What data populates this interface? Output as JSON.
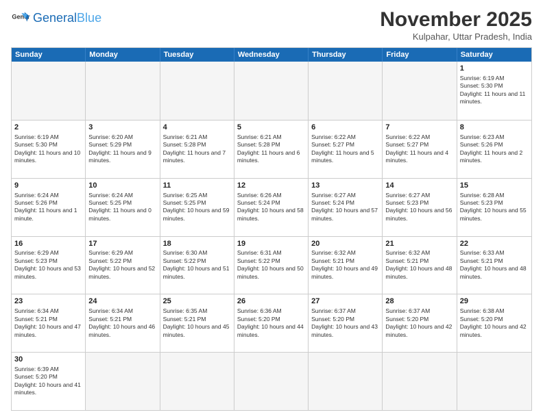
{
  "header": {
    "logo_general": "General",
    "logo_blue": "Blue",
    "month_title": "November 2025",
    "subtitle": "Kulpahar, Uttar Pradesh, India"
  },
  "day_headers": [
    "Sunday",
    "Monday",
    "Tuesday",
    "Wednesday",
    "Thursday",
    "Friday",
    "Saturday"
  ],
  "weeks": [
    [
      {
        "day": "",
        "empty": true
      },
      {
        "day": "",
        "empty": true
      },
      {
        "day": "",
        "empty": true
      },
      {
        "day": "",
        "empty": true
      },
      {
        "day": "",
        "empty": true
      },
      {
        "day": "",
        "empty": true
      },
      {
        "day": "1",
        "sunrise": "6:19 AM",
        "sunset": "5:30 PM",
        "daylight": "11 hours and 11 minutes."
      }
    ],
    [
      {
        "day": "2",
        "sunrise": "6:19 AM",
        "sunset": "5:30 PM",
        "daylight": "11 hours and 10 minutes."
      },
      {
        "day": "3",
        "sunrise": "6:20 AM",
        "sunset": "5:29 PM",
        "daylight": "11 hours and 9 minutes."
      },
      {
        "day": "4",
        "sunrise": "6:21 AM",
        "sunset": "5:28 PM",
        "daylight": "11 hours and 7 minutes."
      },
      {
        "day": "5",
        "sunrise": "6:21 AM",
        "sunset": "5:28 PM",
        "daylight": "11 hours and 6 minutes."
      },
      {
        "day": "6",
        "sunrise": "6:22 AM",
        "sunset": "5:27 PM",
        "daylight": "11 hours and 5 minutes."
      },
      {
        "day": "7",
        "sunrise": "6:22 AM",
        "sunset": "5:27 PM",
        "daylight": "11 hours and 4 minutes."
      },
      {
        "day": "8",
        "sunrise": "6:23 AM",
        "sunset": "5:26 PM",
        "daylight": "11 hours and 2 minutes."
      }
    ],
    [
      {
        "day": "9",
        "sunrise": "6:24 AM",
        "sunset": "5:26 PM",
        "daylight": "11 hours and 1 minute."
      },
      {
        "day": "10",
        "sunrise": "6:24 AM",
        "sunset": "5:25 PM",
        "daylight": "11 hours and 0 minutes."
      },
      {
        "day": "11",
        "sunrise": "6:25 AM",
        "sunset": "5:25 PM",
        "daylight": "10 hours and 59 minutes."
      },
      {
        "day": "12",
        "sunrise": "6:26 AM",
        "sunset": "5:24 PM",
        "daylight": "10 hours and 58 minutes."
      },
      {
        "day": "13",
        "sunrise": "6:27 AM",
        "sunset": "5:24 PM",
        "daylight": "10 hours and 57 minutes."
      },
      {
        "day": "14",
        "sunrise": "6:27 AM",
        "sunset": "5:23 PM",
        "daylight": "10 hours and 56 minutes."
      },
      {
        "day": "15",
        "sunrise": "6:28 AM",
        "sunset": "5:23 PM",
        "daylight": "10 hours and 55 minutes."
      }
    ],
    [
      {
        "day": "16",
        "sunrise": "6:29 AM",
        "sunset": "5:23 PM",
        "daylight": "10 hours and 53 minutes."
      },
      {
        "day": "17",
        "sunrise": "6:29 AM",
        "sunset": "5:22 PM",
        "daylight": "10 hours and 52 minutes."
      },
      {
        "day": "18",
        "sunrise": "6:30 AM",
        "sunset": "5:22 PM",
        "daylight": "10 hours and 51 minutes."
      },
      {
        "day": "19",
        "sunrise": "6:31 AM",
        "sunset": "5:22 PM",
        "daylight": "10 hours and 50 minutes."
      },
      {
        "day": "20",
        "sunrise": "6:32 AM",
        "sunset": "5:21 PM",
        "daylight": "10 hours and 49 minutes."
      },
      {
        "day": "21",
        "sunrise": "6:32 AM",
        "sunset": "5:21 PM",
        "daylight": "10 hours and 48 minutes."
      },
      {
        "day": "22",
        "sunrise": "6:33 AM",
        "sunset": "5:21 PM",
        "daylight": "10 hours and 48 minutes."
      }
    ],
    [
      {
        "day": "23",
        "sunrise": "6:34 AM",
        "sunset": "5:21 PM",
        "daylight": "10 hours and 47 minutes."
      },
      {
        "day": "24",
        "sunrise": "6:34 AM",
        "sunset": "5:21 PM",
        "daylight": "10 hours and 46 minutes."
      },
      {
        "day": "25",
        "sunrise": "6:35 AM",
        "sunset": "5:21 PM",
        "daylight": "10 hours and 45 minutes."
      },
      {
        "day": "26",
        "sunrise": "6:36 AM",
        "sunset": "5:20 PM",
        "daylight": "10 hours and 44 minutes."
      },
      {
        "day": "27",
        "sunrise": "6:37 AM",
        "sunset": "5:20 PM",
        "daylight": "10 hours and 43 minutes."
      },
      {
        "day": "28",
        "sunrise": "6:37 AM",
        "sunset": "5:20 PM",
        "daylight": "10 hours and 42 minutes."
      },
      {
        "day": "29",
        "sunrise": "6:38 AM",
        "sunset": "5:20 PM",
        "daylight": "10 hours and 42 minutes."
      }
    ],
    [
      {
        "day": "30",
        "sunrise": "6:39 AM",
        "sunset": "5:20 PM",
        "daylight": "10 hours and 41 minutes."
      },
      {
        "day": "",
        "empty": true
      },
      {
        "day": "",
        "empty": true
      },
      {
        "day": "",
        "empty": true
      },
      {
        "day": "",
        "empty": true
      },
      {
        "day": "",
        "empty": true
      },
      {
        "day": "",
        "empty": true
      }
    ]
  ]
}
